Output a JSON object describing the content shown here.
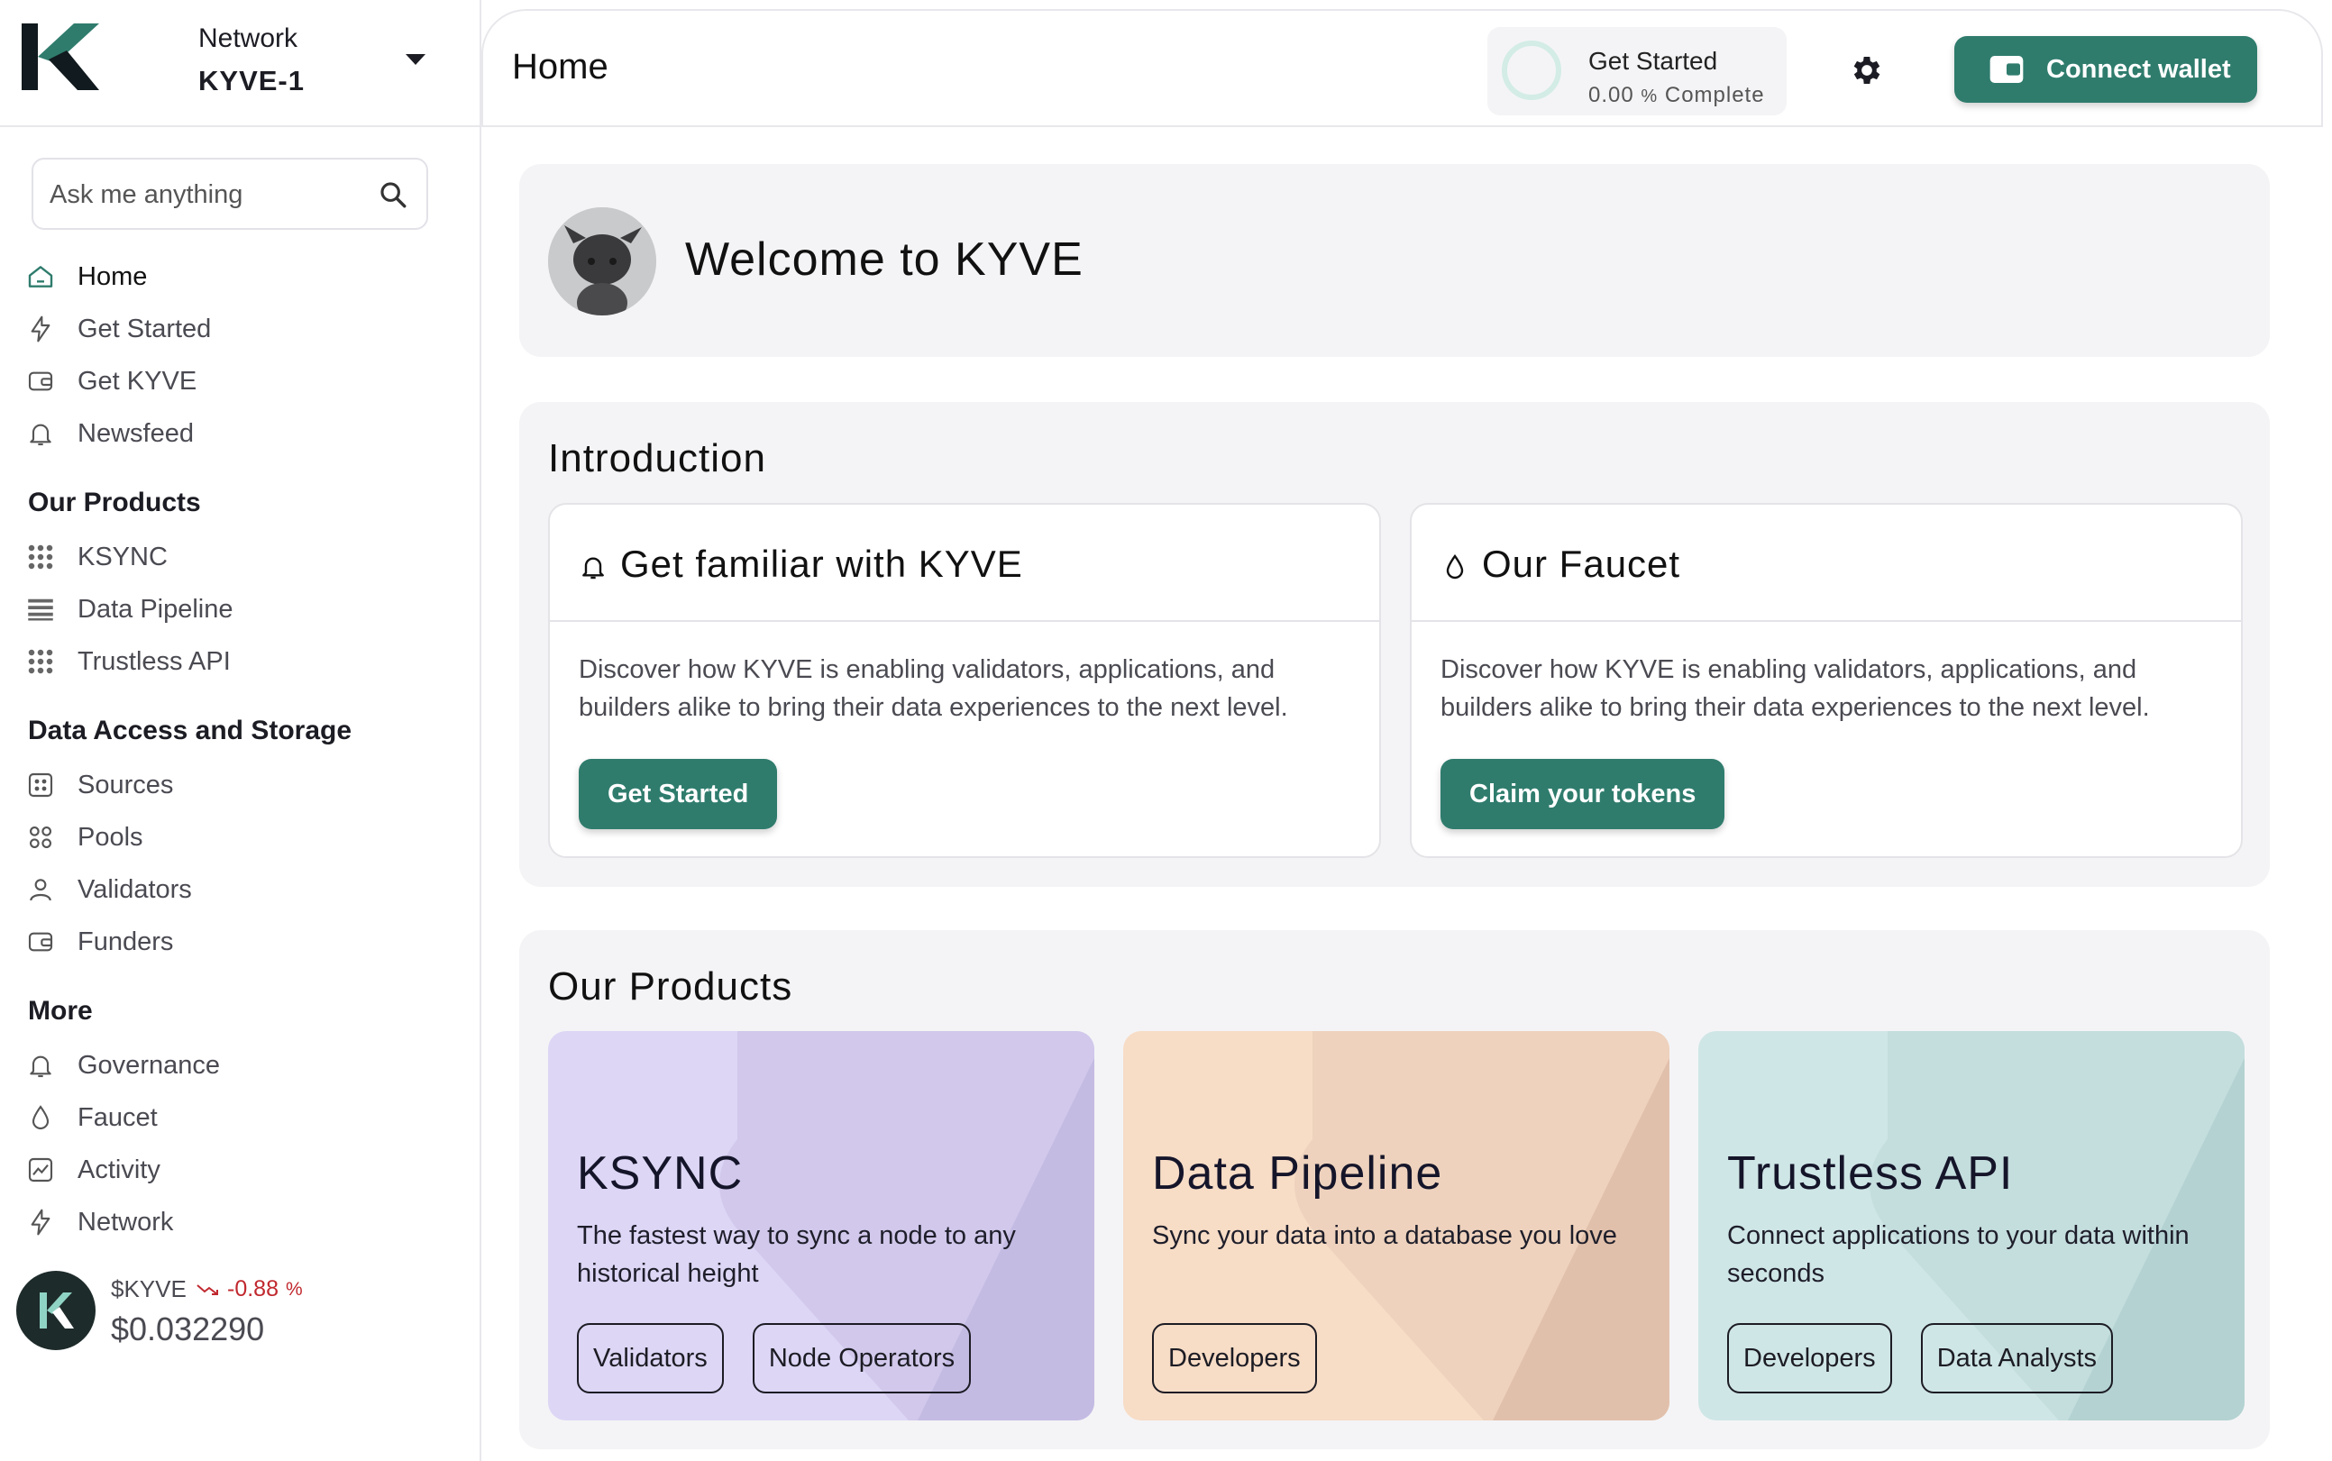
{
  "brand": {
    "network_label": "Network",
    "network_value": "KYVE-1"
  },
  "search": {
    "placeholder": "Ask me anything"
  },
  "nav": {
    "main": [
      {
        "label": "Home",
        "icon": "home-icon"
      },
      {
        "label": "Get Started",
        "icon": "bolt-icon"
      },
      {
        "label": "Get KYVE",
        "icon": "wallet-icon"
      },
      {
        "label": "Newsfeed",
        "icon": "bell-icon"
      }
    ],
    "products_heading": "Our Products",
    "products": [
      {
        "label": "KSYNC",
        "icon": "grid-icon"
      },
      {
        "label": "Data Pipeline",
        "icon": "grid-icon"
      },
      {
        "label": "Trustless API",
        "icon": "grid-icon"
      }
    ],
    "data_heading": "Data Access and Storage",
    "data": [
      {
        "label": "Sources",
        "icon": "source-icon"
      },
      {
        "label": "Pools",
        "icon": "pools-icon"
      },
      {
        "label": "Validators",
        "icon": "user-icon"
      },
      {
        "label": "Funders",
        "icon": "wallet-icon"
      }
    ],
    "more_heading": "More",
    "more": [
      {
        "label": "Governance",
        "icon": "bell-icon"
      },
      {
        "label": "Faucet",
        "icon": "drop-icon"
      },
      {
        "label": "Activity",
        "icon": "activity-icon"
      },
      {
        "label": "Network",
        "icon": "bolt-icon"
      }
    ]
  },
  "price": {
    "ticker": "$KYVE",
    "change": "-0.88",
    "change_unit": "%",
    "value": "$0.032290"
  },
  "header": {
    "title": "Home",
    "progress_title": "Get Started",
    "progress_value": "0.00",
    "progress_unit": "%",
    "progress_suffix": "Complete",
    "wallet_label": "Connect wallet"
  },
  "welcome": {
    "title": "Welcome to KYVE"
  },
  "intro": {
    "heading": "Introduction",
    "cards": [
      {
        "title": "Get familiar with KYVE",
        "icon": "bell-icon",
        "text": "Discover how KYVE is enabling validators, applications, and builders alike to bring their data experiences to the next level.",
        "button": "Get Started"
      },
      {
        "title": "Our Faucet",
        "icon": "drop-icon",
        "text": "Discover how KYVE is enabling validators, applications, and builders alike to bring their data experiences to the next level.",
        "button": "Claim your tokens"
      }
    ]
  },
  "products": {
    "heading": "Our Products",
    "cards": [
      {
        "title": "KSYNC",
        "desc": "The fastest way to sync a node to any historical height",
        "tags": [
          "Validators",
          "Node Operators"
        ],
        "color": "#ddd6f5"
      },
      {
        "title": "Data Pipeline",
        "desc": "Sync your data into a database you love",
        "tags": [
          "Developers"
        ],
        "color": "#f7dcc6"
      },
      {
        "title": "Trustless API",
        "desc": "Connect applications to your data within seconds",
        "tags": [
          "Developers",
          "Data Analysts"
        ],
        "color": "#cfe6e6"
      }
    ]
  },
  "colors": {
    "accent": "#2f7c6d",
    "negative": "#c0282e"
  }
}
